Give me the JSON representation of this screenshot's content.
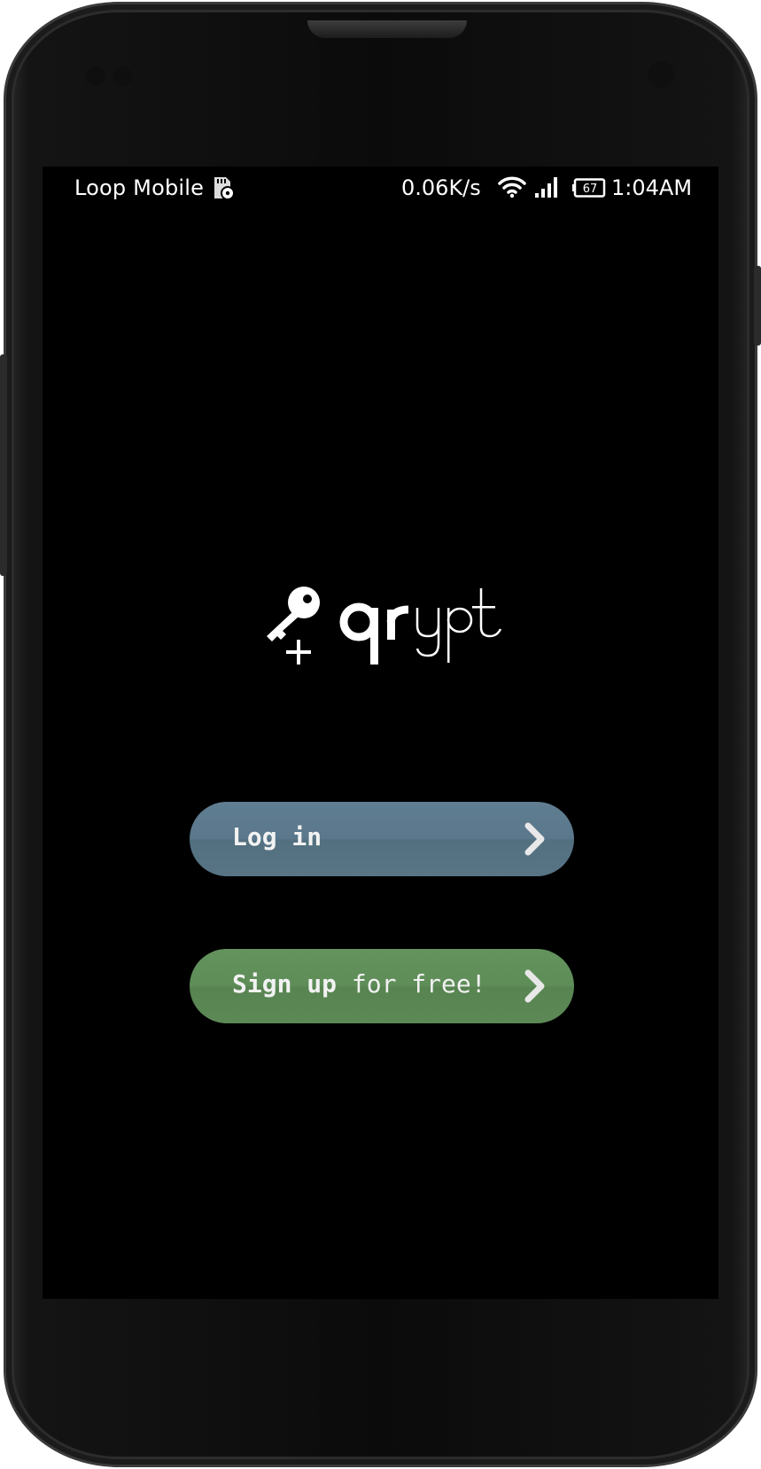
{
  "status_bar": {
    "carrier": "Loop Mobile",
    "net_speed": "0.06K/s",
    "battery_level": "67",
    "time": "1:04AM",
    "icons": [
      "sd-card-icon",
      "wifi-icon",
      "signal-icon",
      "battery-icon"
    ]
  },
  "logo": {
    "icon": "key-plus-icon",
    "text": "qrypt"
  },
  "buttons": {
    "login": {
      "label": "Log in",
      "icon": "chevron-right-icon",
      "color": "#5a778b"
    },
    "signup": {
      "label_bold": "Sign up",
      "label_rest": " for free!",
      "icon": "chevron-right-icon",
      "color": "#5e8d58"
    }
  },
  "colors": {
    "screen_background": "#000000",
    "text": "#ffffff"
  }
}
